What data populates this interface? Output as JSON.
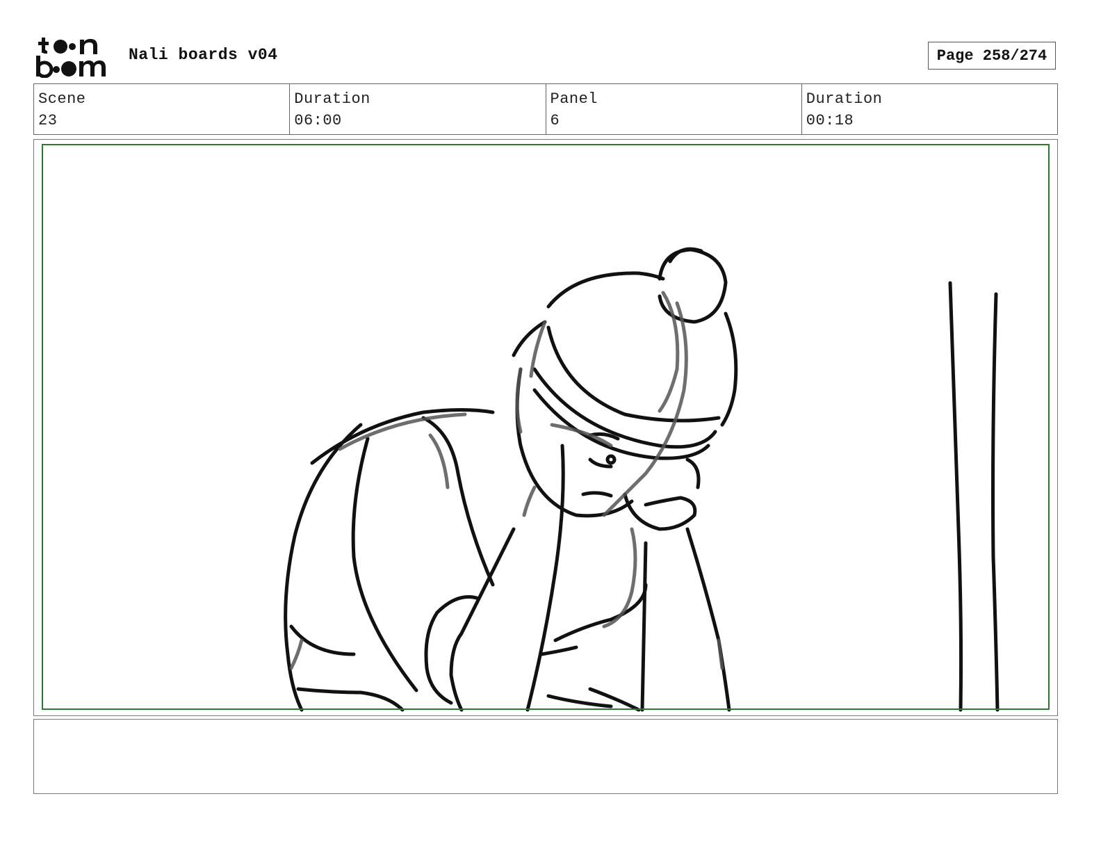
{
  "header": {
    "logo_text_line1": "toon",
    "logo_text_line2": "boom",
    "title": "Nali boards v04",
    "page": "Page 258/274"
  },
  "info": {
    "scene_label": "Scene",
    "scene_value": "23",
    "scene_duration_label": "Duration",
    "scene_duration_value": "06:00",
    "panel_label": "Panel",
    "panel_value": "6",
    "panel_duration_label": "Duration",
    "panel_duration_value": "00:18"
  },
  "panel": {
    "safe_area_color": "#2d7a2d",
    "image_icon": "storyboard-sketch"
  },
  "notes": {
    "text": ""
  }
}
